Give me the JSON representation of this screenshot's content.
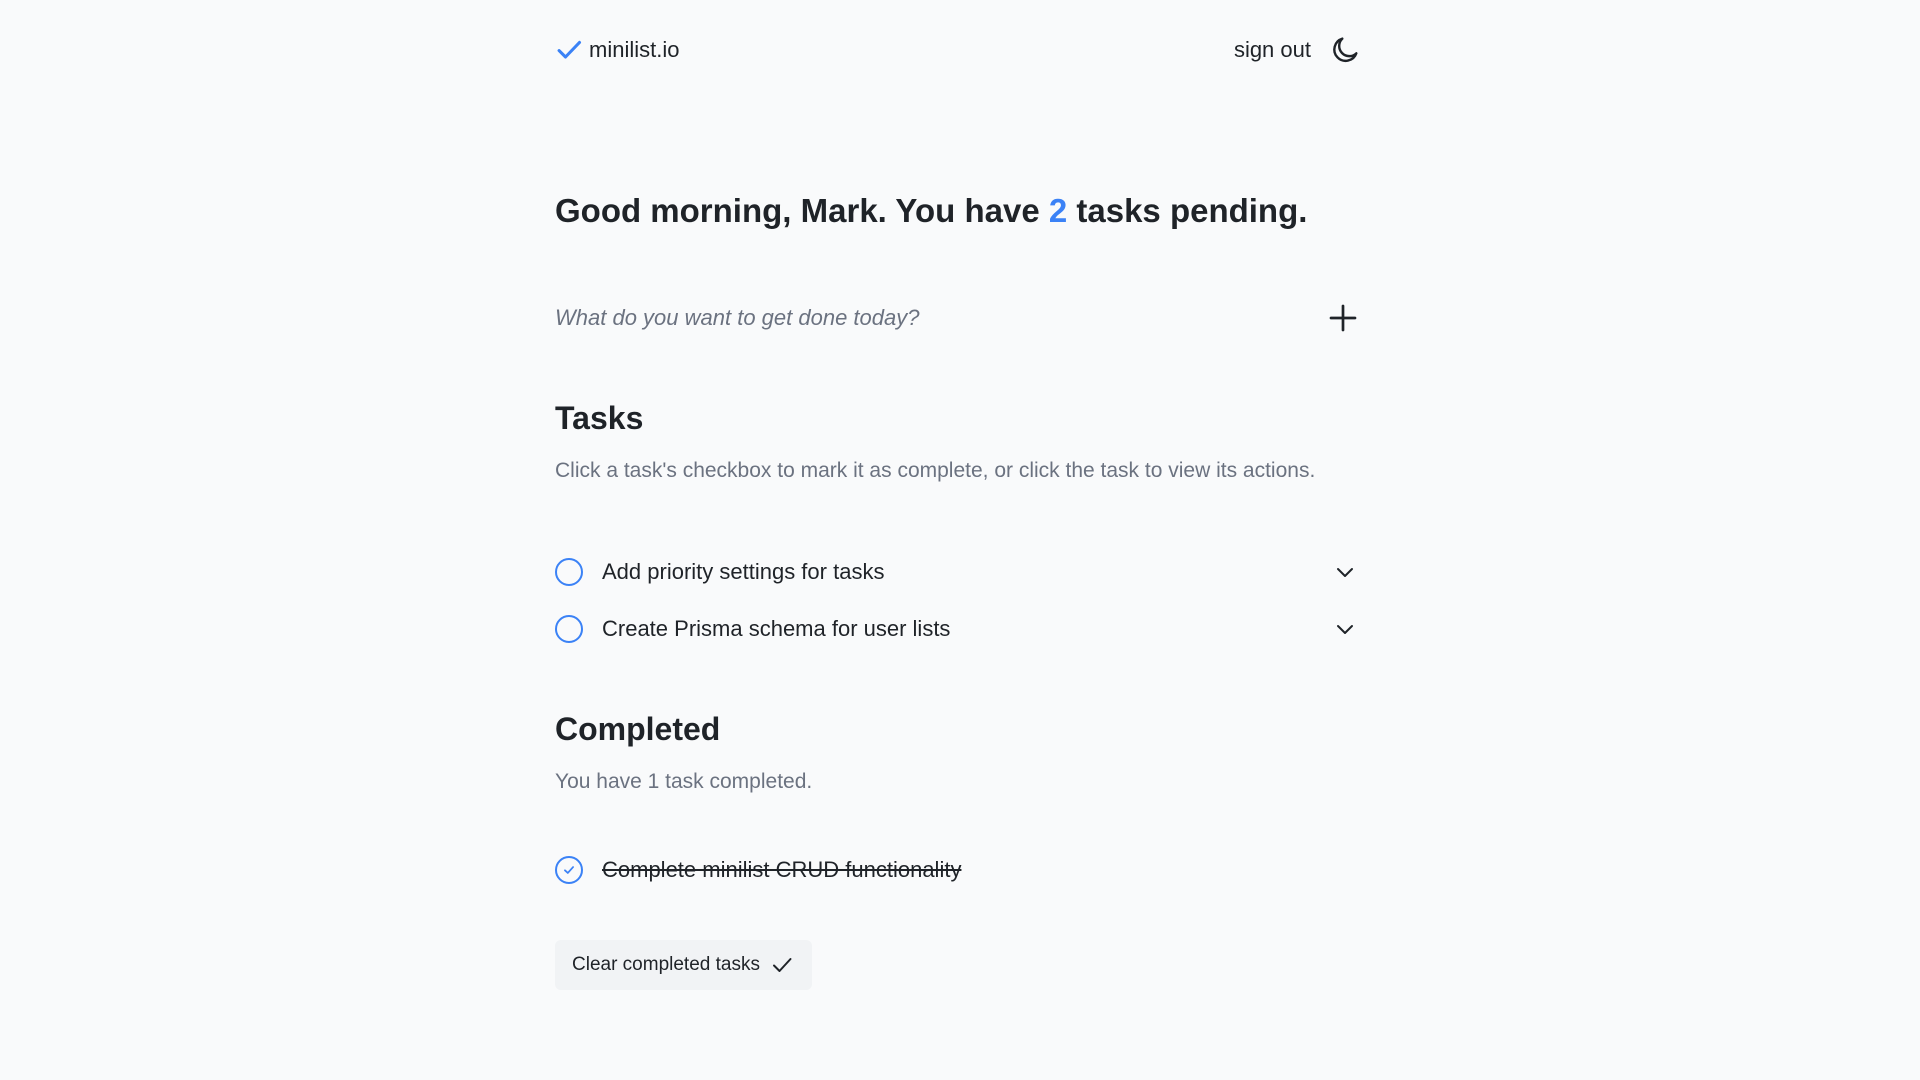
{
  "header": {
    "brand": "minilist.io",
    "sign_out": "sign out"
  },
  "greeting": {
    "prefix": "Good morning, Mark. You have ",
    "count": "2",
    "suffix": " tasks pending."
  },
  "new_task": {
    "placeholder": "What do you want to get done today?",
    "value": ""
  },
  "tasks": {
    "title": "Tasks",
    "subtitle": "Click a task's checkbox to mark it as complete, or click the task to view its actions.",
    "items": [
      {
        "label": "Add priority settings for tasks"
      },
      {
        "label": "Create Prisma schema for user lists"
      }
    ]
  },
  "completed": {
    "title": "Completed",
    "subtitle": "You have 1 task completed.",
    "items": [
      {
        "label": "Complete minilist CRUD functionality"
      }
    ],
    "clear_label": "Clear completed tasks"
  },
  "colors": {
    "accent": "#3b82f6",
    "background": "#f9fafb",
    "text": "#1f2328",
    "muted": "#6b7280"
  },
  "icons": {
    "brand": "check-icon",
    "theme_toggle": "moon-icon",
    "add": "plus-icon",
    "expand": "chevron-down-icon",
    "completed": "check-circle-icon",
    "clear": "check-icon"
  }
}
